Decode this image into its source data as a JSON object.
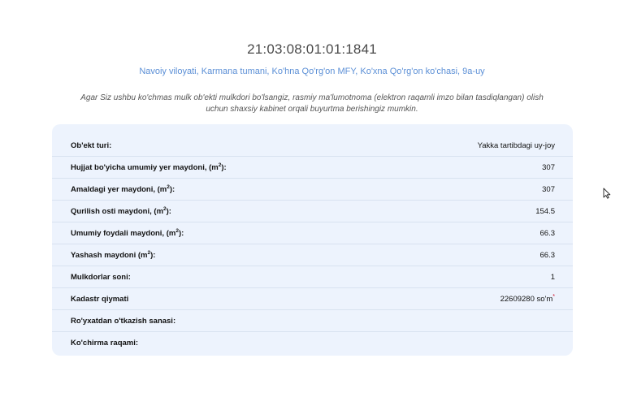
{
  "header": {
    "cadastral_number": "21:03:08:01:01:1841",
    "address": "Navoiy viloyati, Karmana tumani, Ko'hna Qo'rg'on MFY, Ko'xna Qo'rg'on ko'chasi, 9a-uy",
    "notice": "Agar Siz ushbu ko'chmas mulk ob'ekti mulkdori bo'lsangiz, rasmiy ma'lumotnoma (elektron raqamli imzo bilan tasdiqlangan) olish uchun shaxsiy kabinet orqali buyurtma berishingiz mumkin."
  },
  "details": {
    "object_type": {
      "label": "Ob'ekt turi:",
      "value": "Yakka tartibdagi uy-joy"
    },
    "doc_area": {
      "label_pre": "Hujjat bo'yicha umumiy yer maydoni, (m",
      "sup": "2",
      "label_post": "):",
      "value": "307"
    },
    "actual_area": {
      "label_pre": "Amaldagi yer maydoni, (m",
      "sup": "2",
      "label_post": "):",
      "value": "307"
    },
    "built_area": {
      "label_pre": "Qurilish osti maydoni, (m",
      "sup": "2",
      "label_post": "):",
      "value": "154.5"
    },
    "useful_area": {
      "label_pre": "Umumiy foydali maydoni, (m",
      "sup": "2",
      "label_post": "):",
      "value": "66.3"
    },
    "living_area": {
      "label_pre": "Yashash maydoni (m",
      "sup": "2",
      "label_post": "):",
      "value": "66.3"
    },
    "owners_count": {
      "label": "Mulkdorlar soni:",
      "value": "1"
    },
    "cadastral_value": {
      "label": "Kadastr qiymati",
      "value": "22609280 so'm",
      "asterisk": "*"
    },
    "registration_date": {
      "label": "Ro'yxatdan o'tkazish sanasi:",
      "value": ""
    },
    "extract_number": {
      "label": "Ko'chirma raqami:",
      "value": ""
    }
  },
  "colors": {
    "card_bg": "#edf3fd",
    "address_link": "#5b8fd6",
    "asterisk": "#d0021b"
  },
  "icons": {
    "cursor": "mouse-pointer-icon"
  }
}
